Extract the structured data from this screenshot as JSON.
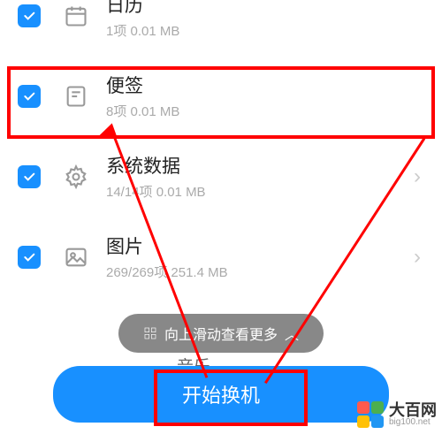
{
  "items": [
    {
      "title": "日历",
      "sub": "1项  0.01 MB",
      "icon": "calendar",
      "chevron": false
    },
    {
      "title": "便签",
      "sub": "8项  0.01 MB",
      "icon": "note",
      "chevron": false
    },
    {
      "title": "系统数据",
      "sub": "14/14项  0.01 MB",
      "icon": "gear",
      "chevron": true
    },
    {
      "title": "图片",
      "sub": "269/269项  251.4 MB",
      "icon": "image",
      "chevron": true
    }
  ],
  "hint": "向上滑动查看更多",
  "hint_suffix": "︿",
  "partial_item": "音乐",
  "primary_button": "开始换机",
  "watermark": {
    "title": "大百网",
    "url": "big100.net"
  },
  "colors": {
    "accent": "#1890ff",
    "annotation": "#ff0000"
  }
}
